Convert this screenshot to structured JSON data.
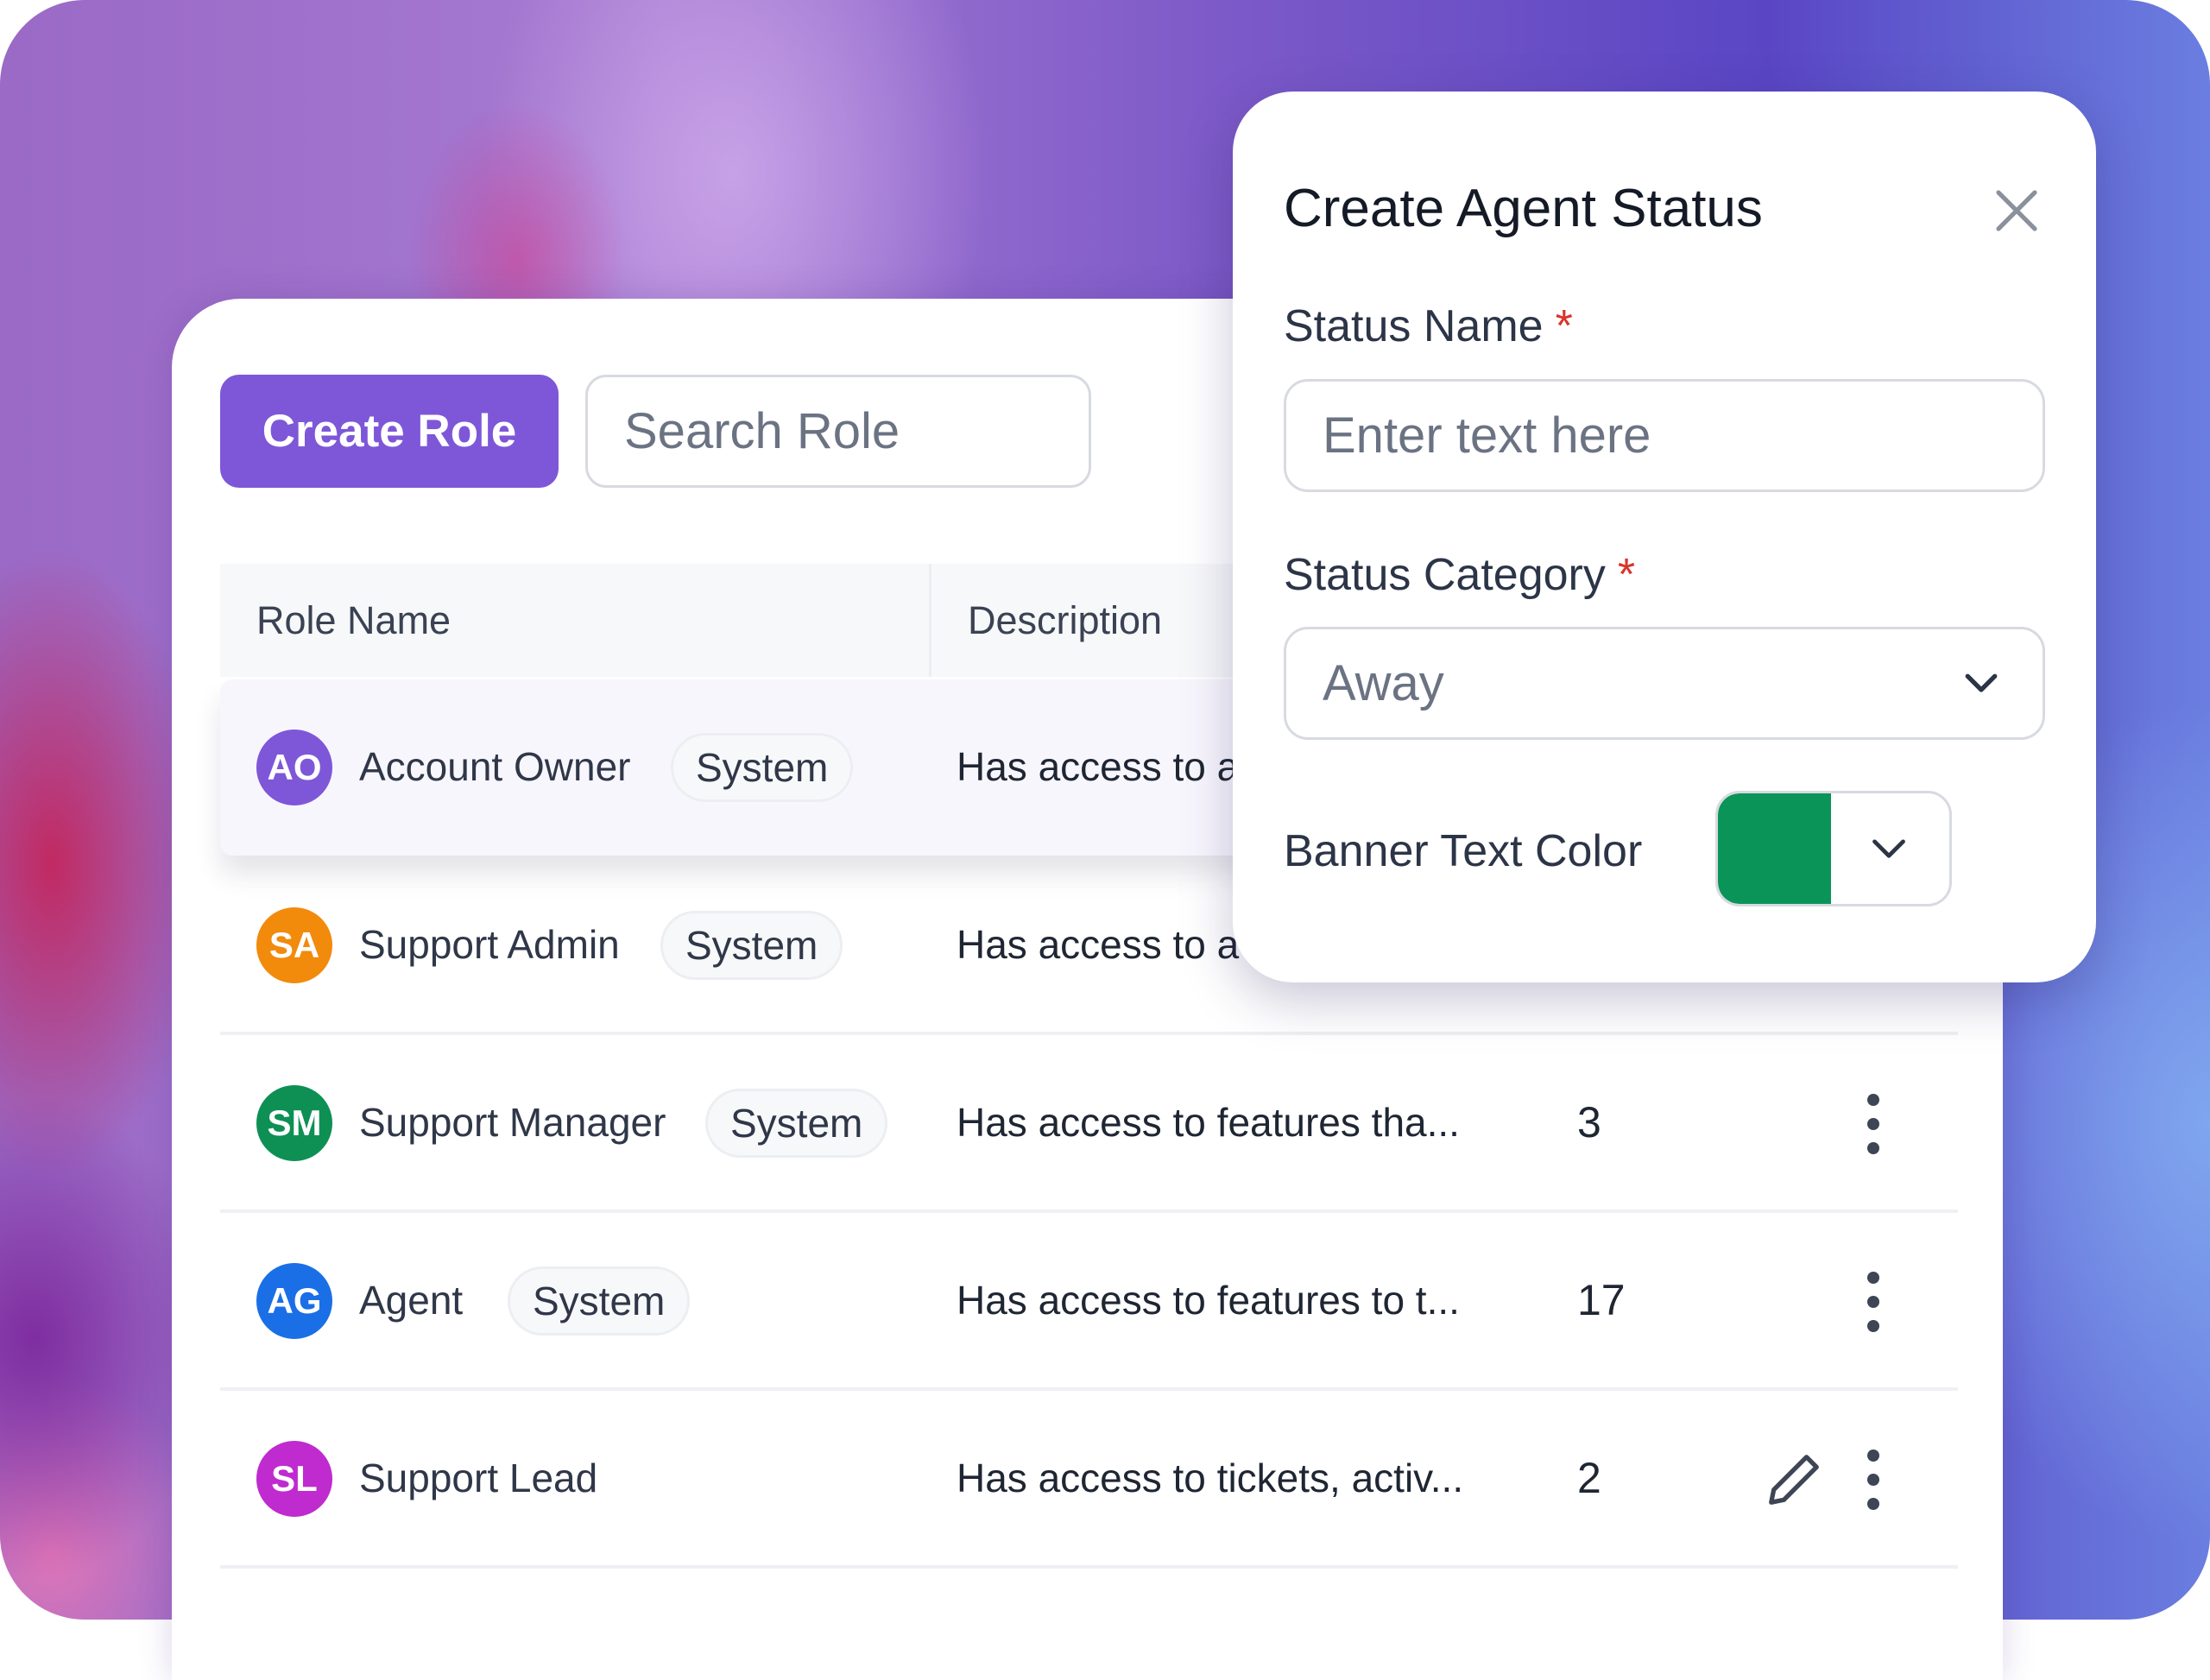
{
  "toolbar": {
    "create_role_label": "Create Role",
    "search_placeholder": "Search Role"
  },
  "table": {
    "columns": [
      "Role Name",
      "Description"
    ],
    "rows": [
      {
        "initials": "AO",
        "avatar_color": "#7e57d8",
        "name": "Account Owner",
        "badge": "System",
        "description": "Has access to a",
        "count": "",
        "highlighted": true
      },
      {
        "initials": "SA",
        "avatar_color": "#f28a0c",
        "name": "Support Admin",
        "badge": "System",
        "description": "Has access to a",
        "count": ""
      },
      {
        "initials": "SM",
        "avatar_color": "#0e9055",
        "name": "Support Manager",
        "badge": "System",
        "description": "Has access to features tha...",
        "count": "3"
      },
      {
        "initials": "AG",
        "avatar_color": "#1a6fe6",
        "name": "Agent",
        "badge": "System",
        "description": "Has access to features to t...",
        "count": "17"
      },
      {
        "initials": "SL",
        "avatar_color": "#bf2bcf",
        "name": "Support Lead",
        "badge": "",
        "description": "Has access to tickets, activ...",
        "count": "2"
      }
    ]
  },
  "modal": {
    "title": "Create Agent Status",
    "close_icon": "close-icon",
    "status_name_label": "Status Name",
    "status_name_placeholder": "Enter text here",
    "required_mark": "*",
    "status_category_label": "Status Category",
    "status_category_value": "Away",
    "banner_text_color_label": "Banner Text Color",
    "banner_text_color_value": "#0b9458"
  },
  "colors": {
    "accent": "#7e57d8",
    "required": "#d9342b"
  }
}
